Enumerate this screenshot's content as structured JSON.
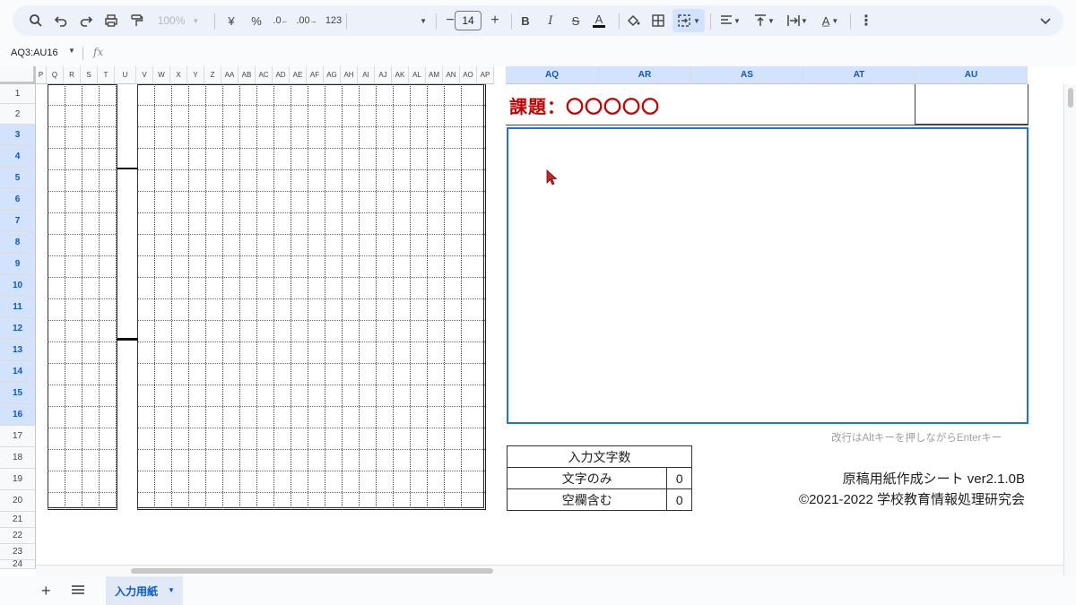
{
  "toolbar": {
    "zoom": "100%",
    "currency": "¥",
    "percent": "%",
    "dec_decrease": ".0",
    "dec_increase": ".00",
    "format_number": "123",
    "font_size": "14"
  },
  "formula_bar": {
    "name_box": "AQ3:AU16"
  },
  "columns_left": [
    "P",
    "Q",
    "R",
    "S",
    "T",
    "U",
    "V",
    "W",
    "X",
    "Y",
    "Z",
    "AA",
    "AB",
    "AC",
    "AD",
    "AE",
    "AF",
    "AG",
    "AH",
    "AI",
    "AJ",
    "AK",
    "AL",
    "AM",
    "AN",
    "AO",
    "AP"
  ],
  "columns_right": [
    "AQ",
    "AR",
    "AS",
    "AT",
    "AU"
  ],
  "rows": [
    "1",
    "2",
    "3",
    "4",
    "5",
    "6",
    "7",
    "8",
    "9",
    "10",
    "11",
    "12",
    "13",
    "14",
    "15",
    "16",
    "17",
    "18",
    "19",
    "20",
    "21",
    "22",
    "23",
    "24"
  ],
  "selected_rows": [
    "3",
    "4",
    "5",
    "6",
    "7",
    "8",
    "9",
    "10",
    "11",
    "12",
    "13",
    "14",
    "15",
    "16"
  ],
  "title": "課題：〇〇〇〇〇",
  "hint": "改行はAltキーを押しながらEnterキー",
  "count_table": {
    "header": "入力文字数",
    "rows": [
      {
        "label": "文字のみ",
        "value": "0"
      },
      {
        "label": "空欄含む",
        "value": "0"
      }
    ]
  },
  "version_line1": "原稿用紙作成シート ver2.1.0B",
  "version_line2": "©2021-2022 学校教育情報処理研究会",
  "sheet_tab": "入力用紙",
  "colors": {
    "title": "#cc0000",
    "selection": "#1a73e8",
    "header_selected": "#d3e3fd"
  }
}
